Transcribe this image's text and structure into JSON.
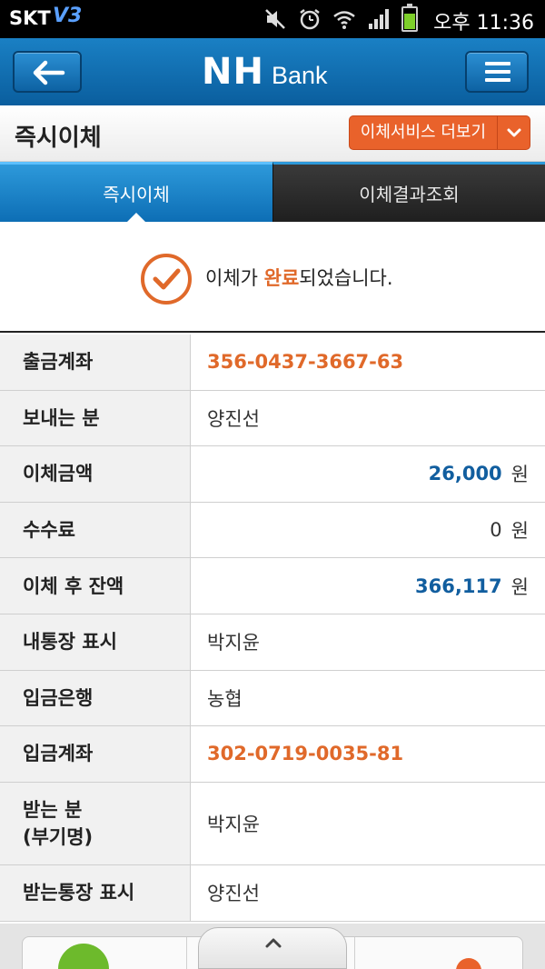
{
  "status_bar": {
    "carrier": "SKT",
    "network": "V3",
    "time": "오후 11:36"
  },
  "header": {
    "logo_main": "NH",
    "logo_sub": "Bank"
  },
  "title_bar": {
    "title": "즉시이체",
    "more_button": "이체서비스 더보기"
  },
  "tabs": [
    {
      "label": "즉시이체",
      "active": true
    },
    {
      "label": "이체결과조회",
      "active": false
    }
  ],
  "result": {
    "prefix": "이체가 ",
    "highlight": "완료",
    "suffix": "되었습니다."
  },
  "details": [
    {
      "label": "출금계좌",
      "value": "356-0437-3667-63"
    },
    {
      "label": "보내는 분",
      "value": "양진선"
    },
    {
      "label": "이체금액",
      "value": "26,000",
      "unit": "원"
    },
    {
      "label": "수수료",
      "value": "0",
      "unit": "원"
    },
    {
      "label": "이체 후 잔액",
      "value": "366,117",
      "unit": "원"
    },
    {
      "label": "내통장 표시",
      "value": "박지윤"
    },
    {
      "label": "입금은행",
      "value": "농협"
    },
    {
      "label": "입금계좌",
      "value": "302-0719-0035-81"
    },
    {
      "label": "받는 분\n(부기명)",
      "value": "박지윤"
    },
    {
      "label": "받는통장 표시",
      "value": "양진선"
    }
  ],
  "colors": {
    "accent_orange": "#e0692a",
    "amount_blue": "#115e9f",
    "header_blue": "#0a5e9e"
  },
  "icons": [
    "back-arrow-icon",
    "menu-icon",
    "chevron-down-icon",
    "check-circle-icon",
    "mute-icon",
    "alarm-icon",
    "wifi-icon",
    "signal-icon",
    "battery-icon",
    "chevron-up-icon"
  ]
}
